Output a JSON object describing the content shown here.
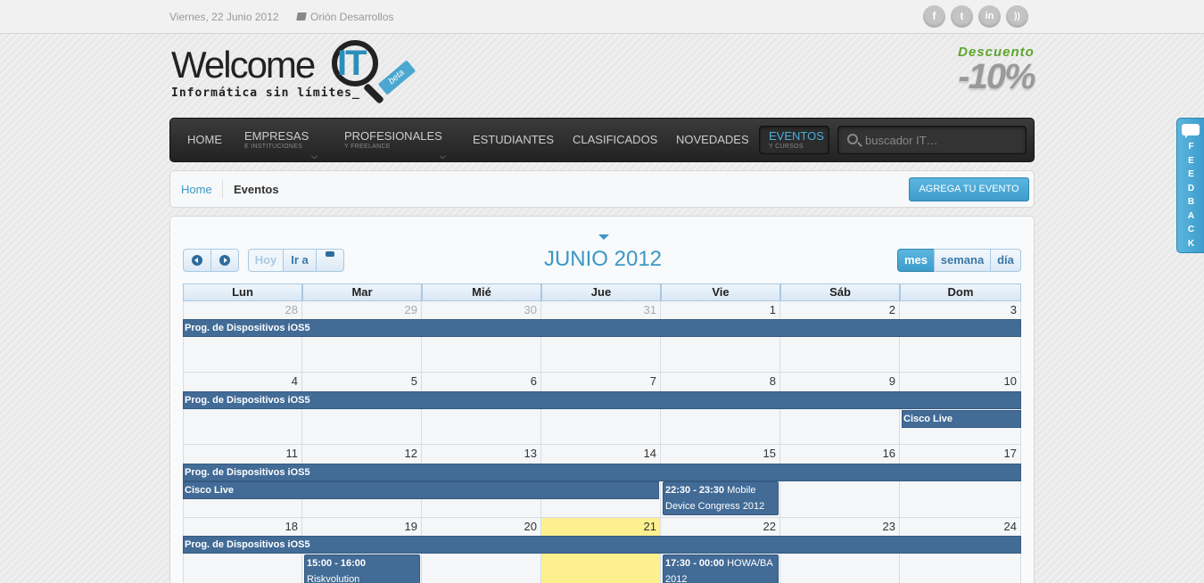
{
  "topbar": {
    "date": "Viernes, 22 Junio 2012",
    "company": "Orión Desarrollos",
    "social": [
      {
        "name": "facebook-icon",
        "glyph": "f"
      },
      {
        "name": "twitter-icon",
        "glyph": "t"
      },
      {
        "name": "linkedin-icon",
        "glyph": "in"
      },
      {
        "name": "rss-icon",
        "glyph": "))"
      }
    ]
  },
  "logo": {
    "word": "Welcome",
    "accent": "IT",
    "badge": "beta",
    "tagline": "Informática sin límites_"
  },
  "promo": {
    "line1": "Descuento",
    "line2": "-10%"
  },
  "nav": {
    "home": "HOME",
    "empresas": "EMPRESAS",
    "empresas_sub": "E INSTITUCIONES",
    "profesionales": "PROFESIONALES",
    "profesionales_sub": "Y FREELANCE",
    "estudiantes": "ESTUDIANTES",
    "clasificados": "CLASIFICADOS",
    "novedades": "NOVEDADES",
    "eventos": "EVENTOS",
    "eventos_sub": "Y CURSOS",
    "search_placeholder": "buscador IT…"
  },
  "breadcrumb": {
    "home": "Home",
    "current": "Eventos",
    "add_button": "AGREGA TU EVENTO"
  },
  "calendar": {
    "title": "JUNIO 2012",
    "today_label": "Hoy",
    "goto_label": "Ir a",
    "views": [
      "mes",
      "semana",
      "día"
    ],
    "active_view": "mes",
    "weekdays": [
      "Lun",
      "Mar",
      "Mié",
      "Jue",
      "Vie",
      "Sáb",
      "Dom"
    ],
    "weeks": [
      {
        "days": [
          "28",
          "29",
          "30",
          "31",
          "1",
          "2",
          "3"
        ],
        "other": [
          true,
          true,
          true,
          true,
          false,
          false,
          false
        ]
      },
      {
        "days": [
          "4",
          "5",
          "6",
          "7",
          "8",
          "9",
          "10"
        ],
        "other": [
          false,
          false,
          false,
          false,
          false,
          false,
          false
        ]
      },
      {
        "days": [
          "11",
          "12",
          "13",
          "14",
          "15",
          "16",
          "17"
        ],
        "other": [
          false,
          false,
          false,
          false,
          false,
          false,
          false
        ]
      },
      {
        "days": [
          "18",
          "19",
          "20",
          "21",
          "22",
          "23",
          "24"
        ],
        "other": [
          false,
          false,
          false,
          false,
          false,
          false,
          false
        ]
      }
    ],
    "today": "21",
    "events": {
      "ios5": "Prog. de Dispositivos iOS5",
      "cisco": "Cisco Live",
      "mobile_time": "22:30 - 23:30",
      "mobile_title": "Mobile Device Congress 2012",
      "risk_time": "15:00 - 16:00",
      "risk_title": "Riskvolution",
      "howa_time": "17:30 - 00:00",
      "howa_title": "HOWA/BA 2012"
    }
  },
  "feedback": {
    "label": "FEEDBACK"
  }
}
